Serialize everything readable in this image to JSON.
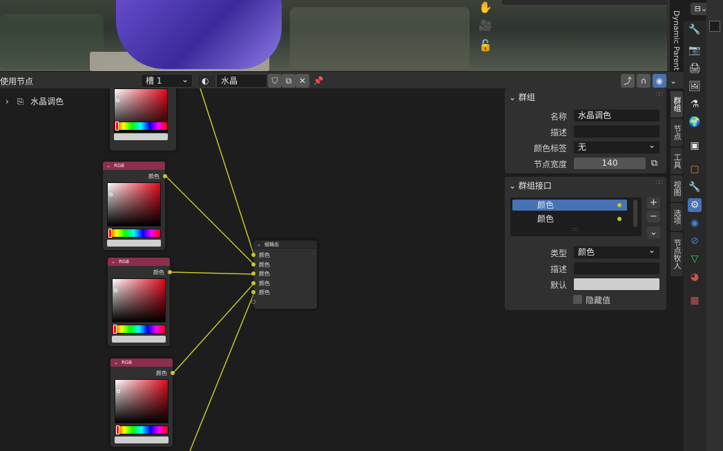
{
  "viewport": {
    "side_label": "Dynamic Parent"
  },
  "header": {
    "editor_label": "使用节点",
    "slot": "槽 1",
    "material_name": "水晶"
  },
  "outliner": {
    "item": "水晶调色"
  },
  "nodes": {
    "rgb_title": "RGB",
    "out_label": "颜色",
    "group_output_title": "组输出",
    "group_output_inputs": [
      "颜色",
      "颜色",
      "颜色",
      "颜色",
      "颜色"
    ]
  },
  "npanel": {
    "group": {
      "title": "群组",
      "name_label": "名称",
      "name_value": "水晶调色",
      "desc_label": "描述",
      "desc_value": "",
      "color_tag_label": "颜色标签",
      "color_tag_value": "无",
      "node_width_label": "节点宽度",
      "node_width_value": "140"
    },
    "interface": {
      "title": "群组接口",
      "items": [
        "颜色",
        "颜色"
      ],
      "type_label": "类型",
      "type_value": "颜色",
      "desc_label": "描述",
      "default_label": "默认",
      "hide_value_label": "隐藏值"
    }
  },
  "tabs": {
    "editor_tabs": [
      "群组",
      "节点",
      "工具",
      "视图",
      "选项",
      "节点牧人"
    ]
  },
  "colors": {
    "accent": "#4772b3",
    "node_header_rgb": "#8c2e4c",
    "socket_color": "#c7c729"
  }
}
